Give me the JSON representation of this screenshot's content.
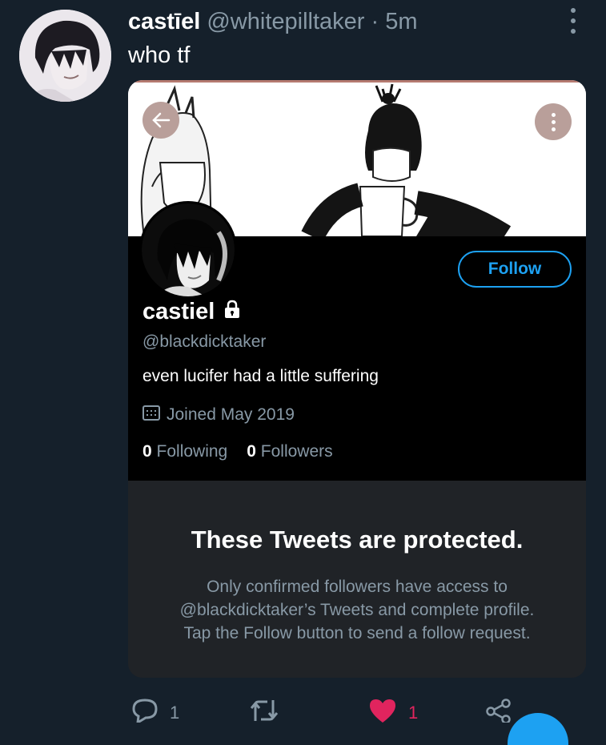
{
  "tweet": {
    "display_name": "castīel",
    "handle": "@whitepilltaker",
    "separator": "·",
    "time": "5m",
    "text": "who tf"
  },
  "card": {
    "profile": {
      "name": "castiel",
      "handle": "@blackdicktaker",
      "bio": "even lucifer had a little suffering",
      "joined": "Joined May 2019",
      "following_count": "0",
      "following_label": "Following",
      "followers_count": "0",
      "followers_label": "Followers",
      "follow_label": "Follow"
    },
    "protected": {
      "title": "These Tweets are protected.",
      "line1": "Only confirmed followers have access to",
      "line2": "@blackdicktaker’s Tweets and complete profile.",
      "line3": "Tap the Follow button to send a follow request."
    }
  },
  "actions": {
    "reply_count": "1",
    "like_count": "1"
  },
  "colors": {
    "background": "#15202b",
    "accent": "#1da1f2",
    "like": "#e0245e",
    "muted": "#8899a6"
  },
  "icons": [
    "more-icon",
    "back-arrow-icon",
    "kebab-icon",
    "lock-icon",
    "calendar-icon",
    "reply-icon",
    "retweet-icon",
    "heart-icon",
    "share-icon"
  ]
}
